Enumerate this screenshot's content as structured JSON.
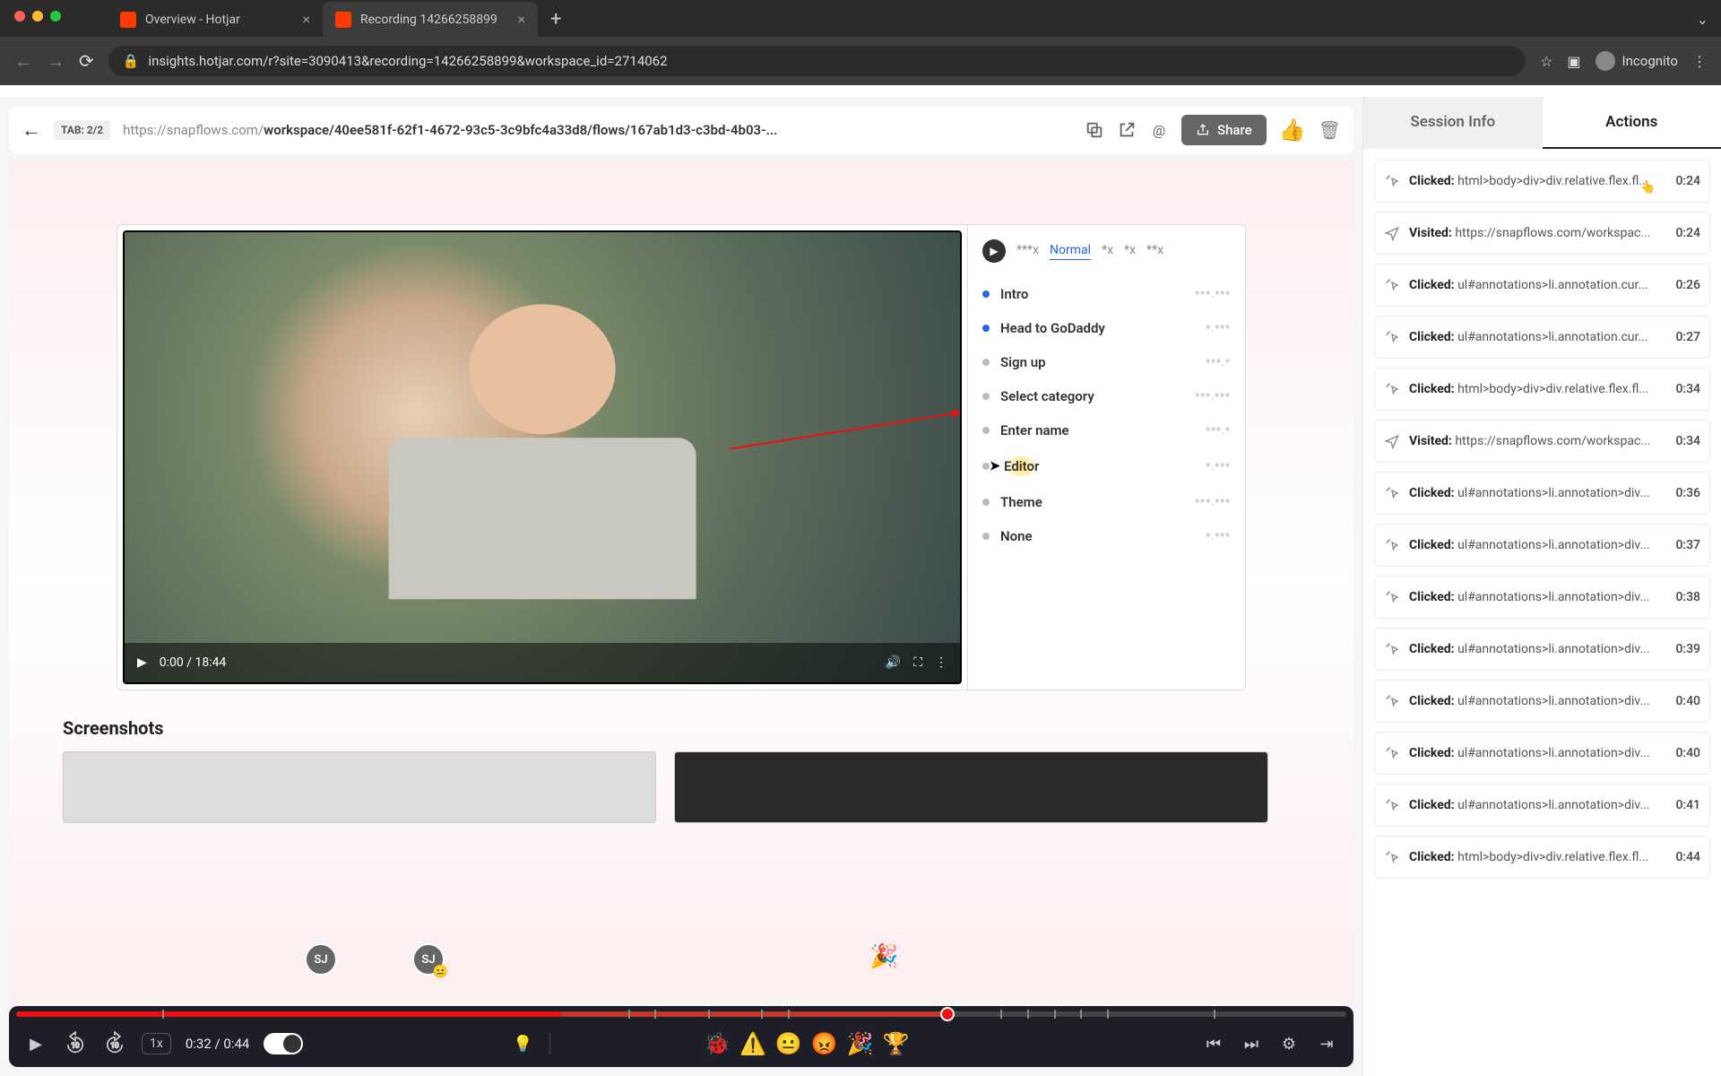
{
  "browser": {
    "tabs": [
      {
        "label": "Overview - Hotjar",
        "active": false
      },
      {
        "label": "Recording 14266258899",
        "active": true
      }
    ],
    "url": "insights.hotjar.com/r?site=3090413&recording=14266258899&workspace_id=2714062",
    "incognito_label": "Incognito"
  },
  "topbar": {
    "tab_badge": "TAB: 2/2",
    "url_prefix": "https://snapflows.com/",
    "url_bold": "workspace/40ee581f-62f1-4672-93c5-3c9bfc4a33d8/flows/167ab1d3-c3bd-4b03-...",
    "share_label": "Share"
  },
  "video": {
    "current": "0:00",
    "duration": "18:44"
  },
  "sidepane": {
    "tabs": [
      "***x",
      "Normal",
      "*x",
      "*x",
      "**x"
    ],
    "active_tab": 1,
    "rows": [
      {
        "label": "Intro",
        "blue": true,
        "wave": "***.***"
      },
      {
        "label": "Head to GoDaddy",
        "blue": true,
        "wave": "*.***"
      },
      {
        "label": "Sign up",
        "blue": false,
        "wave": "***.*"
      },
      {
        "label": "Select category",
        "blue": false,
        "wave": "***.***"
      },
      {
        "label": "Enter name",
        "blue": false,
        "wave": "***.*"
      },
      {
        "label": "Editor",
        "blue": false,
        "wave": "*.***",
        "highlight": true
      },
      {
        "label": "Theme",
        "blue": false,
        "wave": "***.***"
      },
      {
        "label": "None",
        "blue": false,
        "wave": "*.***"
      }
    ]
  },
  "screenshots_heading": "Screenshots",
  "timeline": {
    "avatars": [
      {
        "label": "SJ",
        "left_pct": 22
      },
      {
        "label": "SJ",
        "left_pct": 30,
        "badge": "😐"
      }
    ],
    "party_left_pct": 64,
    "played_pct": 41,
    "buffered_end_pct": 70,
    "handle_pct": 70,
    "ticks_pct": [
      11,
      46,
      48,
      52,
      56,
      58,
      74,
      76,
      78,
      80,
      82,
      90
    ]
  },
  "playbar": {
    "speed": "1x",
    "time": "0:32 / 0:44",
    "emojis": [
      "🐞",
      "⚠️",
      "😐",
      "😡",
      "🎉",
      "🏆"
    ]
  },
  "right_panel": {
    "tabs": {
      "info": "Session Info",
      "actions": "Actions"
    },
    "active": "actions",
    "actions": [
      {
        "icon": "click",
        "label": "Clicked:",
        "detail": "html>body>div>div.relative.flex.fl...",
        "time": "0:24",
        "cursor": true
      },
      {
        "icon": "visit",
        "label": "Visited:",
        "detail": "https://snapflows.com/workspac...",
        "time": "0:24"
      },
      {
        "icon": "click",
        "label": "Clicked:",
        "detail": "ul#annotations>li.annotation.cur...",
        "time": "0:26"
      },
      {
        "icon": "click",
        "label": "Clicked:",
        "detail": "ul#annotations>li.annotation.cur...",
        "time": "0:27"
      },
      {
        "icon": "click",
        "label": "Clicked:",
        "detail": "html>body>div>div.relative.flex.fl...",
        "time": "0:34"
      },
      {
        "icon": "visit",
        "label": "Visited:",
        "detail": "https://snapflows.com/workspac...",
        "time": "0:34"
      },
      {
        "icon": "click",
        "label": "Clicked:",
        "detail": "ul#annotations>li.annotation>div...",
        "time": "0:36"
      },
      {
        "icon": "click",
        "label": "Clicked:",
        "detail": "ul#annotations>li.annotation>div...",
        "time": "0:37"
      },
      {
        "icon": "click",
        "label": "Clicked:",
        "detail": "ul#annotations>li.annotation>div...",
        "time": "0:38"
      },
      {
        "icon": "click",
        "label": "Clicked:",
        "detail": "ul#annotations>li.annotation>div...",
        "time": "0:39"
      },
      {
        "icon": "click",
        "label": "Clicked:",
        "detail": "ul#annotations>li.annotation>div...",
        "time": "0:40"
      },
      {
        "icon": "click",
        "label": "Clicked:",
        "detail": "ul#annotations>li.annotation>div...",
        "time": "0:40"
      },
      {
        "icon": "click",
        "label": "Clicked:",
        "detail": "ul#annotations>li.annotation>div...",
        "time": "0:41"
      },
      {
        "icon": "click",
        "label": "Clicked:",
        "detail": "html>body>div>div.relative.flex.fl...",
        "time": "0:44"
      }
    ]
  }
}
